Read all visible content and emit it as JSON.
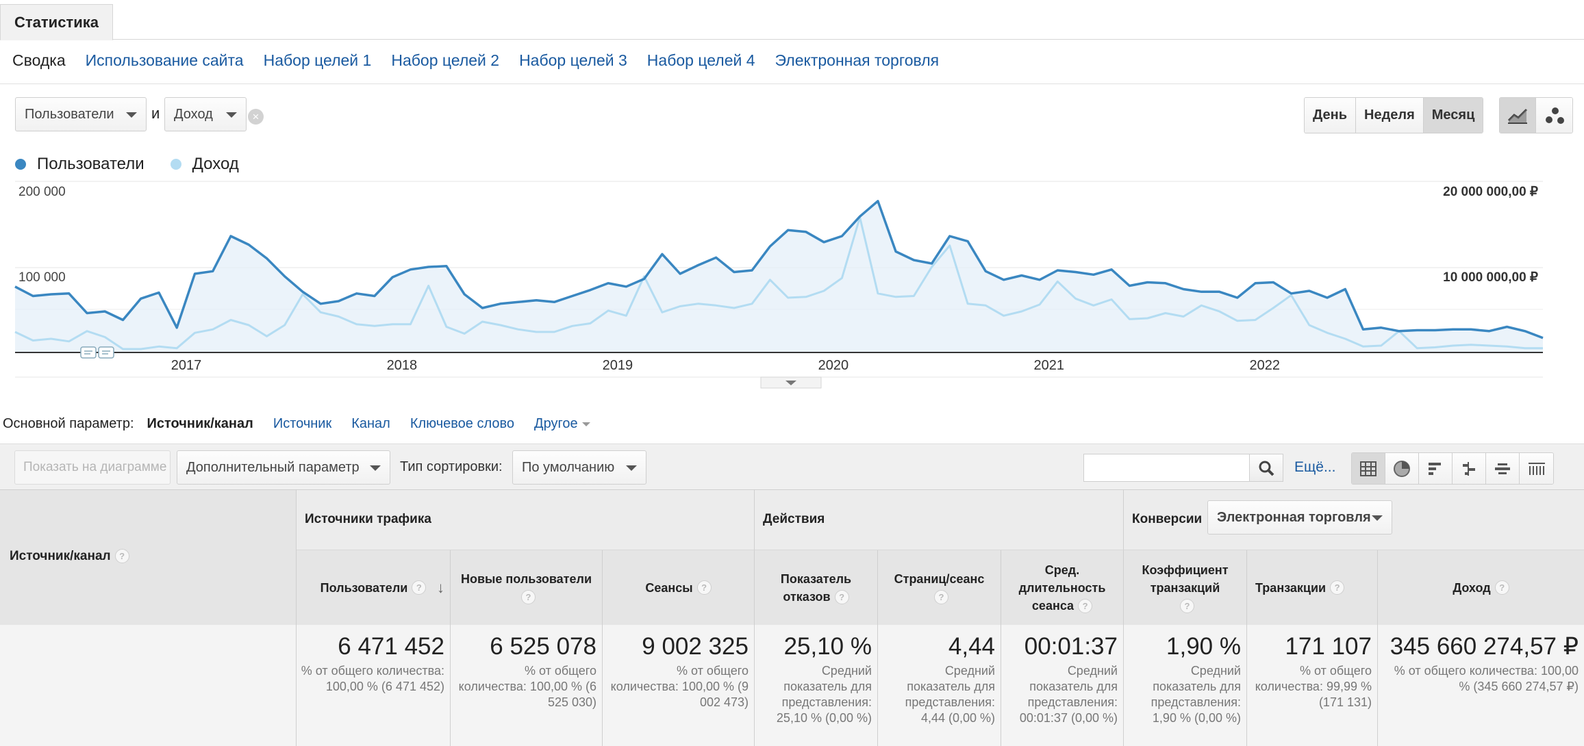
{
  "header": {
    "tab": "Статистика"
  },
  "subnav": {
    "items": [
      "Сводка",
      "Использование сайта",
      "Набор целей 1",
      "Набор целей 2",
      "Набор целей 3",
      "Набор целей 4",
      "Электронная торговля"
    ]
  },
  "metrics": {
    "metric1": "Пользователи",
    "and": "и",
    "metric2": "Доход",
    "clear": "×"
  },
  "period": {
    "day": "День",
    "week": "Неделя",
    "month": "Месяц",
    "selected": "Месяц"
  },
  "legend": [
    {
      "name": "Пользователи",
      "color": "#3a87c1"
    },
    {
      "name": "Доход",
      "color": "#b3dcf2"
    }
  ],
  "chart_data": {
    "type": "line",
    "title": "",
    "y_left_ticks": [
      "200 000",
      "100 000"
    ],
    "y_right_ticks": [
      "20 000 000,00 ₽",
      "10 000 000,00 ₽"
    ],
    "ylim_left": [
      0,
      200000
    ],
    "ylim_right": [
      0,
      20000000
    ],
    "x_tick_labels": [
      "2017",
      "2018",
      "2019",
      "2020",
      "2021",
      "2022"
    ],
    "x_start_year": 2016,
    "months": 71,
    "series": [
      {
        "name": "Пользователи",
        "color": "#3a87c1",
        "axis": "left",
        "values": [
          77000,
          66000,
          68000,
          69000,
          46000,
          48000,
          38000,
          63000,
          70000,
          29000,
          92000,
          95000,
          136000,
          126000,
          110000,
          89000,
          71000,
          57000,
          60000,
          69000,
          66000,
          88000,
          97000,
          100000,
          101000,
          68000,
          52000,
          57000,
          59000,
          61000,
          59000,
          66000,
          73000,
          81000,
          77000,
          86000,
          115000,
          92000,
          102000,
          111000,
          94000,
          96000,
          124000,
          143000,
          141000,
          129000,
          136000,
          159000,
          177000,
          118000,
          108000,
          104000,
          136000,
          130000,
          95000,
          85000,
          90000,
          85000,
          96000,
          94000,
          91000,
          97000,
          78000,
          82000,
          81000,
          74000,
          71000,
          71000,
          64000,
          81000,
          82000,
          69000,
          72000,
          64000,
          74000,
          27000,
          29000,
          25000,
          26000,
          26000,
          27000,
          27000,
          25000,
          30000,
          25000,
          17000
        ]
      },
      {
        "name": "Доход",
        "color": "#b3dcf2",
        "axis": "right",
        "values": [
          2400000,
          1400000,
          1600000,
          1300000,
          2500000,
          1800000,
          400000,
          400000,
          700000,
          500000,
          2300000,
          2700000,
          3800000,
          3200000,
          1900000,
          3200000,
          6800000,
          4700000,
          4200000,
          3300000,
          3100000,
          3300000,
          3300000,
          7800000,
          3000000,
          2200000,
          3600000,
          3200000,
          2700000,
          2400000,
          2400000,
          3100000,
          3400000,
          4900000,
          4300000,
          8900000,
          4700000,
          5400000,
          5700000,
          5500000,
          5200000,
          5700000,
          8500000,
          6400000,
          6500000,
          7200000,
          8700000,
          15800000,
          6900000,
          6500000,
          6600000,
          10000000,
          12500000,
          5700000,
          5500000,
          4300000,
          4800000,
          5600000,
          8300000,
          6300000,
          5500000,
          6200000,
          3900000,
          4000000,
          4600000,
          4200000,
          5500000,
          4800000,
          3700000,
          3800000,
          5200000,
          6700000,
          3200000,
          2300000,
          1600000,
          700000,
          800000,
          2500000,
          500000,
          600000,
          800000,
          900000,
          800000,
          700000,
          500000,
          500000
        ]
      }
    ]
  },
  "dimensions": {
    "label": "Основной параметр:",
    "current": "Источник/канал",
    "options": [
      "Источник",
      "Канал",
      "Ключевое слово"
    ],
    "other": "Другое"
  },
  "toolbar": {
    "plot_rows": "Показать на диаграмме",
    "secondary": "Дополнительный параметр",
    "sort_label": "Тип сортировки:",
    "sort_value": "По умолчанию",
    "search_placeholder": "",
    "more": "Ещё..."
  },
  "table": {
    "dim_header": "Источник/канал",
    "groups": {
      "acquisition": "Источники трафика",
      "behavior": "Действия",
      "conversions": "Конверсии",
      "conversions_select": "Электронная торговля"
    },
    "columns": [
      {
        "label": "Пользователи",
        "total": "6 471 452",
        "sub": "% от общего количества: 100,00 % (6 471 452)"
      },
      {
        "label": "Новые пользователи",
        "total": "6 525 078",
        "sub": "% от общего количества: 100,00 % (6 525 030)"
      },
      {
        "label": "Сеансы",
        "total": "9 002 325",
        "sub": "% от общего количества: 100,00 % (9 002 473)"
      },
      {
        "label": "Показатель отказов",
        "total": "25,10 %",
        "sub": "Средний показатель для представления: 25,10 % (0,00 %)"
      },
      {
        "label": "Страниц/сеанс",
        "total": "4,44",
        "sub": "Средний показатель для представления: 4,44 (0,00 %)"
      },
      {
        "label": "Сред. длительность сеанса",
        "total": "00:01:37",
        "sub": "Средний показатель для представления: 00:01:37 (0,00 %)"
      },
      {
        "label": "Коэффициент транзакций",
        "total": "1,90 %",
        "sub": "Средний показатель для представления: 1,90 % (0,00 %)"
      },
      {
        "label": "Транзакции",
        "total": "171 107",
        "sub": "% от общего количества: 99,99 % (171 131)"
      },
      {
        "label": "Доход",
        "total": "345 660 274,57 ₽",
        "sub": "% от общего количества: 100,00 % (345 660 274,57 ₽)"
      }
    ]
  }
}
